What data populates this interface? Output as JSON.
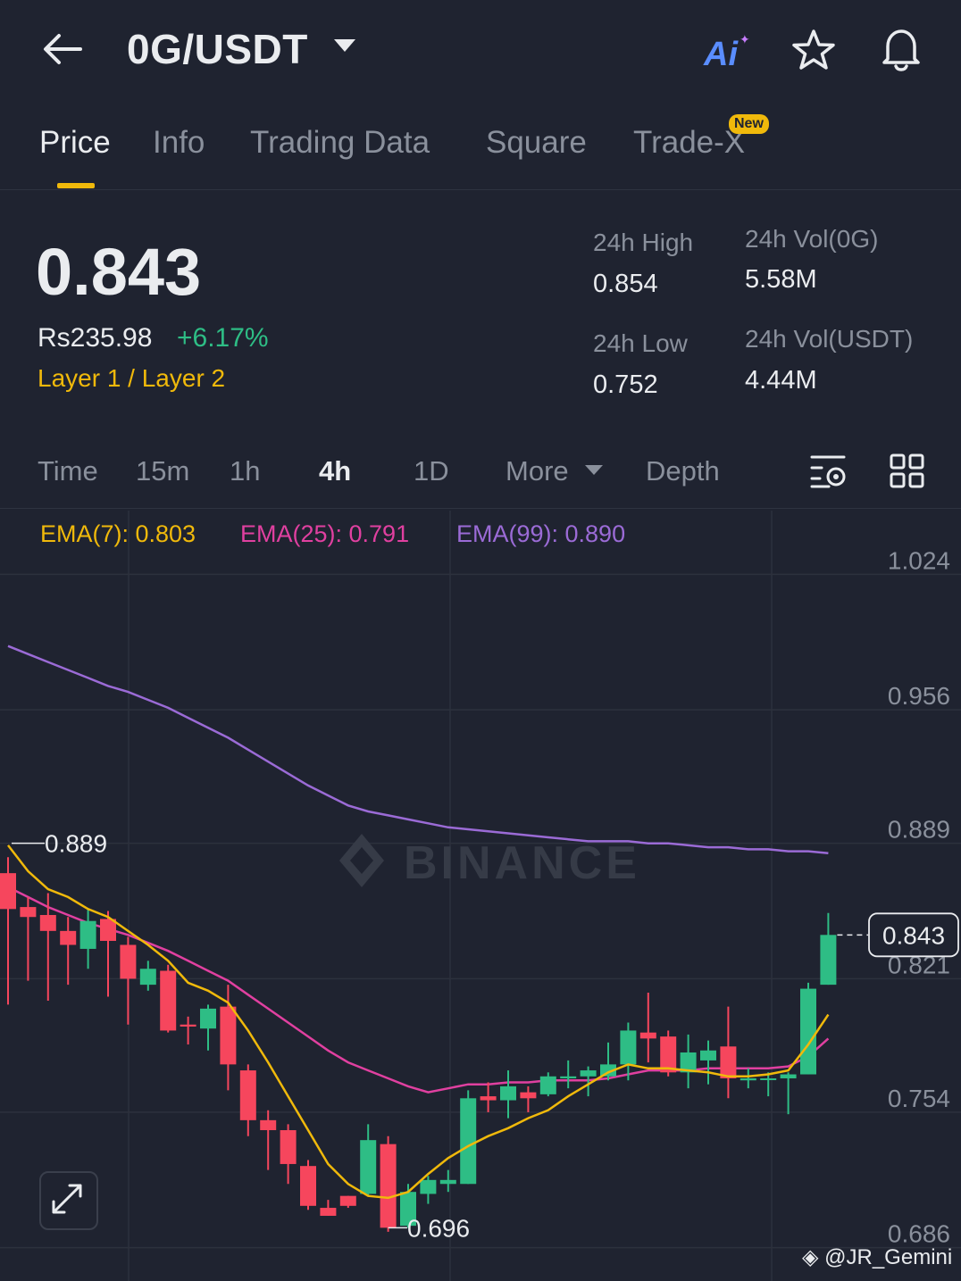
{
  "header": {
    "pair": "0G/USDT",
    "ai_label": "Ai"
  },
  "tabs": [
    {
      "label": "Price",
      "active": true
    },
    {
      "label": "Info"
    },
    {
      "label": "Trading Data"
    },
    {
      "label": "Square"
    },
    {
      "label": "Trade-X",
      "badge": "New"
    }
  ],
  "summary": {
    "last_price": "0.843",
    "fiat_price": "Rs235.98",
    "change_pct": "+6.17%",
    "sector": "Layer 1 / Layer 2",
    "high_label": "24h High",
    "high_value": "0.854",
    "low_label": "24h Low",
    "low_value": "0.752",
    "vol_base_label": "24h Vol(0G)",
    "vol_base_value": "5.58M",
    "vol_quote_label": "24h Vol(USDT)",
    "vol_quote_value": "4.44M"
  },
  "intervals": [
    "Time",
    "15m",
    "1h",
    "4h",
    "1D",
    "More",
    "Depth"
  ],
  "active_interval": "4h",
  "indicators": {
    "ema7": "EMA(7): 0.803",
    "ema25": "EMA(25): 0.791",
    "ema99": "EMA(99): 0.890"
  },
  "colors": {
    "up": "#2ebd85",
    "down": "#f6465d",
    "ema7": "#f0b90b",
    "ema25": "#e040a0",
    "ema99": "#9b6bd6",
    "background": "#1f2330"
  },
  "chart_data": {
    "type": "candlestick",
    "ylim": [
      0.676,
      1.03
    ],
    "y_ticks": [
      "1.024",
      "0.956",
      "0.889",
      "0.821",
      "0.754",
      "0.686"
    ],
    "current_price_label": "0.843",
    "high_marker": "0.889",
    "low_marker": "0.696",
    "watermark": "BINANCE",
    "candles": [
      {
        "o": 0.874,
        "h": 0.882,
        "l": 0.808,
        "c": 0.856
      },
      {
        "o": 0.857,
        "h": 0.862,
        "l": 0.82,
        "c": 0.852
      },
      {
        "o": 0.853,
        "h": 0.864,
        "l": 0.81,
        "c": 0.845
      },
      {
        "o": 0.845,
        "h": 0.852,
        "l": 0.818,
        "c": 0.838
      },
      {
        "o": 0.836,
        "h": 0.856,
        "l": 0.826,
        "c": 0.85
      },
      {
        "o": 0.851,
        "h": 0.855,
        "l": 0.812,
        "c": 0.84
      },
      {
        "o": 0.838,
        "h": 0.842,
        "l": 0.798,
        "c": 0.821
      },
      {
        "o": 0.818,
        "h": 0.83,
        "l": 0.815,
        "c": 0.826
      },
      {
        "o": 0.825,
        "h": 0.828,
        "l": 0.794,
        "c": 0.795
      },
      {
        "o": 0.798,
        "h": 0.802,
        "l": 0.788,
        "c": 0.797
      },
      {
        "o": 0.796,
        "h": 0.808,
        "l": 0.785,
        "c": 0.806
      },
      {
        "o": 0.807,
        "h": 0.818,
        "l": 0.765,
        "c": 0.778
      },
      {
        "o": 0.775,
        "h": 0.778,
        "l": 0.742,
        "c": 0.75
      },
      {
        "o": 0.75,
        "h": 0.755,
        "l": 0.725,
        "c": 0.745
      },
      {
        "o": 0.745,
        "h": 0.748,
        "l": 0.718,
        "c": 0.728
      },
      {
        "o": 0.727,
        "h": 0.73,
        "l": 0.705,
        "c": 0.707
      },
      {
        "o": 0.706,
        "h": 0.71,
        "l": 0.702,
        "c": 0.702
      },
      {
        "o": 0.712,
        "h": 0.712,
        "l": 0.706,
        "c": 0.707
      },
      {
        "o": 0.713,
        "h": 0.748,
        "l": 0.712,
        "c": 0.74
      },
      {
        "o": 0.738,
        "h": 0.742,
        "l": 0.694,
        "c": 0.696
      },
      {
        "o": 0.697,
        "h": 0.718,
        "l": 0.696,
        "c": 0.714
      },
      {
        "o": 0.713,
        "h": 0.722,
        "l": 0.708,
        "c": 0.72
      },
      {
        "o": 0.718,
        "h": 0.725,
        "l": 0.714,
        "c": 0.72
      },
      {
        "o": 0.718,
        "h": 0.765,
        "l": 0.718,
        "c": 0.761
      },
      {
        "o": 0.762,
        "h": 0.769,
        "l": 0.754,
        "c": 0.76
      },
      {
        "o": 0.76,
        "h": 0.775,
        "l": 0.751,
        "c": 0.767
      },
      {
        "o": 0.764,
        "h": 0.767,
        "l": 0.754,
        "c": 0.761
      },
      {
        "o": 0.763,
        "h": 0.774,
        "l": 0.762,
        "c": 0.772
      },
      {
        "o": 0.771,
        "h": 0.78,
        "l": 0.766,
        "c": 0.772
      },
      {
        "o": 0.772,
        "h": 0.777,
        "l": 0.762,
        "c": 0.775
      },
      {
        "o": 0.772,
        "h": 0.789,
        "l": 0.77,
        "c": 0.778
      },
      {
        "o": 0.778,
        "h": 0.799,
        "l": 0.77,
        "c": 0.795
      },
      {
        "o": 0.794,
        "h": 0.814,
        "l": 0.779,
        "c": 0.791
      },
      {
        "o": 0.792,
        "h": 0.795,
        "l": 0.772,
        "c": 0.774
      },
      {
        "o": 0.774,
        "h": 0.793,
        "l": 0.766,
        "c": 0.784
      },
      {
        "o": 0.78,
        "h": 0.79,
        "l": 0.768,
        "c": 0.785
      },
      {
        "o": 0.787,
        "h": 0.807,
        "l": 0.761,
        "c": 0.771
      },
      {
        "o": 0.77,
        "h": 0.776,
        "l": 0.766,
        "c": 0.771
      },
      {
        "o": 0.771,
        "h": 0.774,
        "l": 0.762,
        "c": 0.771
      },
      {
        "o": 0.771,
        "h": 0.774,
        "l": 0.753,
        "c": 0.773
      },
      {
        "o": 0.773,
        "h": 0.819,
        "l": 0.773,
        "c": 0.816
      },
      {
        "o": 0.818,
        "h": 0.854,
        "l": 0.818,
        "c": 0.843
      }
    ],
    "ema7": [
      0.888,
      0.875,
      0.866,
      0.862,
      0.856,
      0.852,
      0.845,
      0.838,
      0.83,
      0.819,
      0.815,
      0.809,
      0.795,
      0.779,
      0.762,
      0.745,
      0.728,
      0.718,
      0.712,
      0.711,
      0.714,
      0.723,
      0.731,
      0.737,
      0.742,
      0.746,
      0.751,
      0.755,
      0.762,
      0.768,
      0.774,
      0.778,
      0.776,
      0.776,
      0.775,
      0.774,
      0.772,
      0.772,
      0.773,
      0.775,
      0.788,
      0.803
    ],
    "ema25": [
      0.867,
      0.862,
      0.857,
      0.853,
      0.849,
      0.846,
      0.843,
      0.839,
      0.835,
      0.83,
      0.825,
      0.82,
      0.813,
      0.806,
      0.799,
      0.792,
      0.785,
      0.779,
      0.775,
      0.771,
      0.767,
      0.764,
      0.766,
      0.768,
      0.768,
      0.769,
      0.769,
      0.77,
      0.77,
      0.77,
      0.771,
      0.773,
      0.775,
      0.775,
      0.775,
      0.776,
      0.776,
      0.776,
      0.776,
      0.777,
      0.782,
      0.791
    ],
    "ema99": [
      0.988,
      0.984,
      0.98,
      0.976,
      0.972,
      0.968,
      0.965,
      0.961,
      0.957,
      0.952,
      0.947,
      0.942,
      0.936,
      0.93,
      0.924,
      0.918,
      0.913,
      0.908,
      0.905,
      0.903,
      0.901,
      0.899,
      0.897,
      0.896,
      0.895,
      0.894,
      0.893,
      0.892,
      0.891,
      0.89,
      0.89,
      0.89,
      0.889,
      0.889,
      0.888,
      0.887,
      0.887,
      0.886,
      0.886,
      0.885,
      0.885,
      0.884
    ]
  },
  "credit": "@JR_Gemini"
}
